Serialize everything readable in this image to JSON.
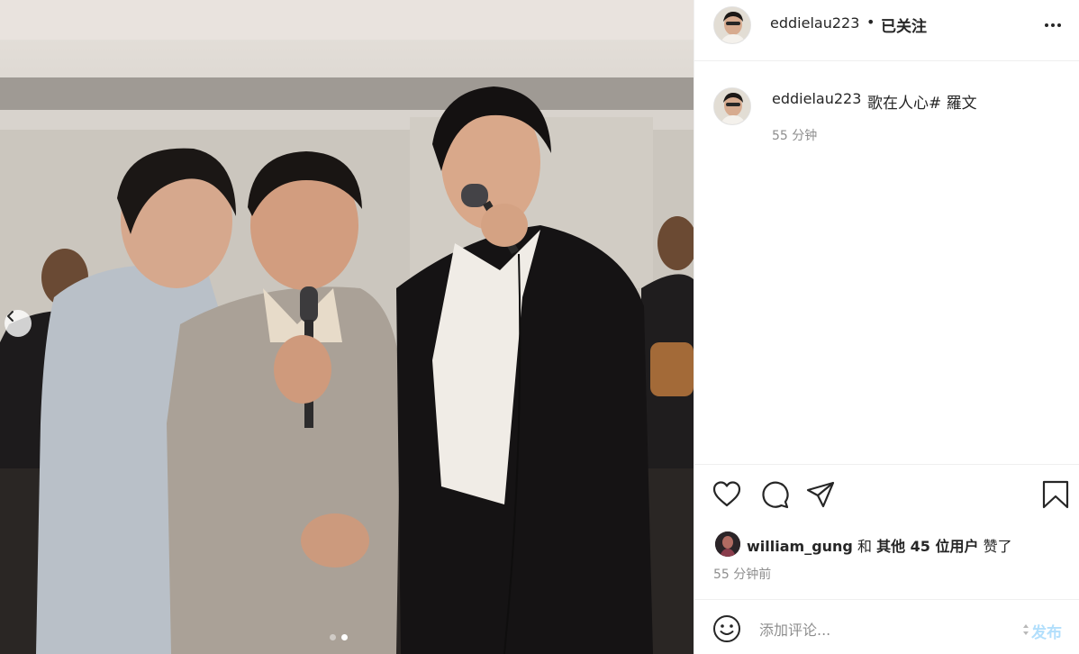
{
  "photo": {
    "prev_button_icon": "chevron-left-icon",
    "carousel": {
      "total": 2,
      "active_index": 1
    }
  },
  "header": {
    "username": "eddielau223",
    "separator": "•",
    "follow_status": "已关注",
    "more_icon": "more-horizontal-icon"
  },
  "caption": {
    "username": "eddielau223",
    "text": "歌在人心# 羅文",
    "time": "55 分钟"
  },
  "actions": {
    "icons": [
      "heart-icon",
      "comment-icon",
      "send-icon",
      "bookmark-icon"
    ]
  },
  "likes": {
    "user": "william_gung",
    "joiner": "和",
    "others": "其他 45 位用户",
    "suffix": "赞了"
  },
  "post_time": "55 分钟前",
  "comment": {
    "placeholder": "添加评论...",
    "post_label": "发布",
    "post_color": "#b2dffc"
  },
  "colors": {
    "text_primary": "#262626",
    "text_secondary": "#8e8e8e",
    "divider": "#efefef"
  }
}
